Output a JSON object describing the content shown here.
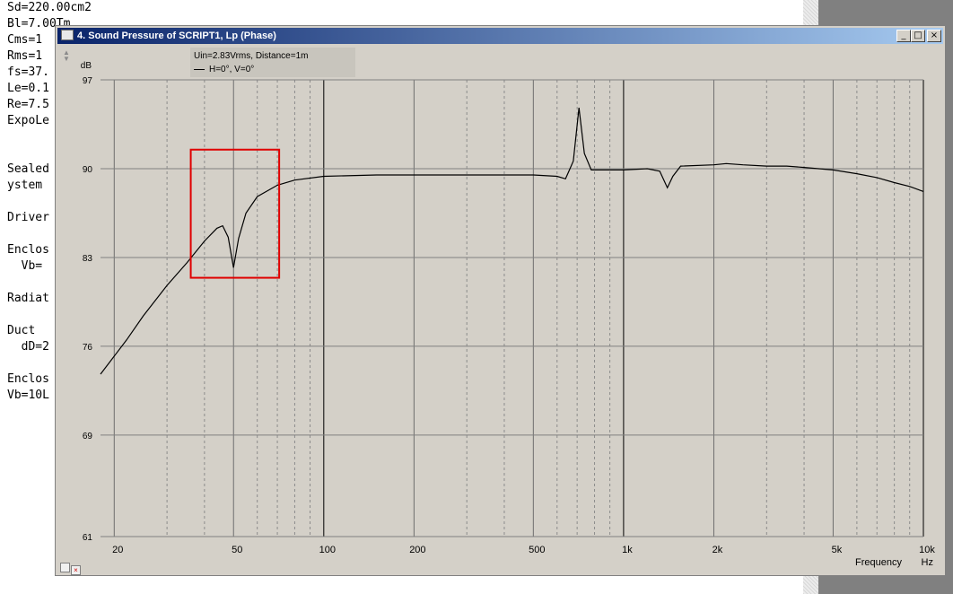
{
  "script_lines": [
    "Sd=220.00cm2",
    "Bl=7.00Tm",
    "Cms=1",
    "Rms=1",
    "fs=37.",
    "Le=0.1",
    "Re=7.5",
    "ExpoLe",
    "",
    "",
    "Sealed",
    "ystem ",
    "",
    "Driver",
    "",
    "Enclos",
    "  Vb=",
    "",
    "Radiat",
    "",
    "Duct",
    "  dD=2",
    "",
    "Enclos",
    "Vb=10L"
  ],
  "window": {
    "title": "4. Sound Pressure of SCRIPT1, Lp (Phase)",
    "minimize": "_",
    "maximize": "□",
    "close": "×"
  },
  "legend": {
    "line1": "Uin=2.83Vrms, Distance=1m",
    "line2": "H=0°, V=0°"
  },
  "chart_data": {
    "type": "line",
    "y_unit": "dB",
    "x_unit": "Hz",
    "xlabel": "Frequency",
    "x_scale": "log",
    "xlim": [
      18,
      10000
    ],
    "ylim": [
      61,
      97
    ],
    "y_ticks": [
      97,
      90,
      83,
      76,
      69,
      61
    ],
    "x_tick_labels": [
      {
        "value": 20,
        "label": "20"
      },
      {
        "value": 50,
        "label": "50"
      },
      {
        "value": 100,
        "label": "100"
      },
      {
        "value": 200,
        "label": "200"
      },
      {
        "value": 500,
        "label": "500"
      },
      {
        "value": 1000,
        "label": "1k"
      },
      {
        "value": 2000,
        "label": "2k"
      },
      {
        "value": 5000,
        "label": "5k"
      },
      {
        "value": 10000,
        "label": "10k"
      }
    ],
    "grid": true,
    "series": [
      {
        "points": [
          [
            18,
            73.8
          ],
          [
            22,
            76.5
          ],
          [
            25,
            78.4
          ],
          [
            30,
            80.8
          ],
          [
            35,
            82.6
          ],
          [
            40,
            84.3
          ],
          [
            44,
            85.3
          ],
          [
            46,
            85.5
          ],
          [
            48,
            84.6
          ],
          [
            50,
            82.2
          ],
          [
            52,
            84.5
          ],
          [
            55,
            86.5
          ],
          [
            60,
            87.8
          ],
          [
            70,
            88.7
          ],
          [
            80,
            89.1
          ],
          [
            100,
            89.4
          ],
          [
            150,
            89.5
          ],
          [
            200,
            89.5
          ],
          [
            300,
            89.5
          ],
          [
            500,
            89.5
          ],
          [
            600,
            89.4
          ],
          [
            640,
            89.2
          ],
          [
            680,
            90.6
          ],
          [
            710,
            94.8
          ],
          [
            740,
            91.2
          ],
          [
            780,
            89.9
          ],
          [
            1000,
            89.9
          ],
          [
            1200,
            90.0
          ],
          [
            1320,
            89.8
          ],
          [
            1400,
            88.5
          ],
          [
            1460,
            89.4
          ],
          [
            1550,
            90.2
          ],
          [
            2000,
            90.3
          ],
          [
            2200,
            90.4
          ],
          [
            2500,
            90.3
          ],
          [
            3000,
            90.2
          ],
          [
            3500,
            90.2
          ],
          [
            4000,
            90.1
          ],
          [
            5000,
            89.9
          ],
          [
            6000,
            89.6
          ],
          [
            7000,
            89.3
          ],
          [
            8000,
            88.9
          ],
          [
            9000,
            88.6
          ],
          [
            10000,
            88.2
          ]
        ]
      }
    ],
    "annotations": [
      {
        "type": "highlight_box",
        "color": "#e00000",
        "x_range": [
          36,
          71
        ],
        "y_range": [
          81.4,
          91.5
        ]
      }
    ]
  }
}
